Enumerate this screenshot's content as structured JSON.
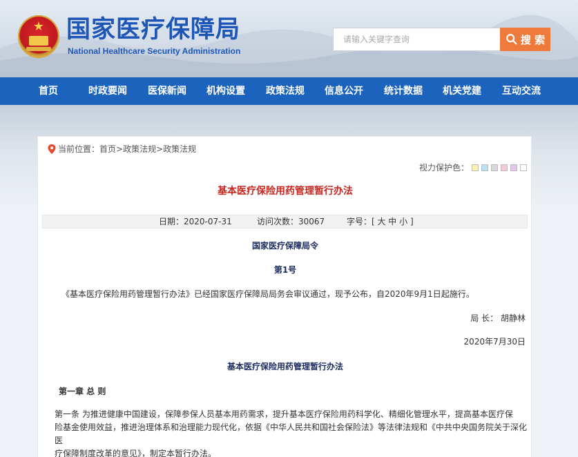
{
  "header": {
    "title": "国家医疗保障局",
    "subtitle": "National Healthcare Security Administration",
    "emblem_icon": "national-emblem-icon"
  },
  "search": {
    "placeholder": "请输入关键字查询",
    "button_label": "搜 索",
    "button_color": "#ee7a3c"
  },
  "nav": {
    "color": "#1b63bd",
    "items": [
      "首页",
      "时政要闻",
      "医保新闻",
      "机构设置",
      "政策法规",
      "信息公开",
      "统计数据",
      "机关党建",
      "互动交流"
    ]
  },
  "breadcrumb": {
    "prefix": "当前位置：",
    "items": [
      "首页",
      "政策法规",
      "政策法规"
    ],
    "separator": ">"
  },
  "eye_protect": {
    "label": "视力保护色：",
    "swatches": [
      "#fbf2b0",
      "#b9dff3",
      "#d8d8d8",
      "#f4c9dc",
      "#e2c6f0",
      "#ffffff"
    ]
  },
  "article": {
    "title": "基本医疗保险用药管理暂行办法",
    "date_label": "日期：2020-07-31",
    "views_label": "访问次数：",
    "views_value": "30067",
    "font_size_label": "字号：[ 大 中 小 ]",
    "order_title": "国家医疗保障局令",
    "order_number": "第1号",
    "intro": "《基本医疗保险用药管理暂行办法》已经国家医疗保障局局务会审议通过，现予公布，自2020年9月1日起施行。",
    "signer": "局 长：  胡静林",
    "sign_date": "2020年7月30日",
    "body_title": "基本医疗保险用药管理暂行办法",
    "chapter": "第一章   总 则",
    "article1_line1": "第一条    为推进健康中国建设，保障参保人员基本用药需求，提升基本医疗保险用药科学化、精细化管理水平，提高基本医疗保",
    "article1_line2": "险基金使用效益，推进治理体系和治理能力现代化，依据《中华人民共和国社会保险法》等法律法规和《中共中央国务院关于深化医",
    "article1_line3": "疗保障制度改革的意见》，制定本暂行办法。"
  }
}
